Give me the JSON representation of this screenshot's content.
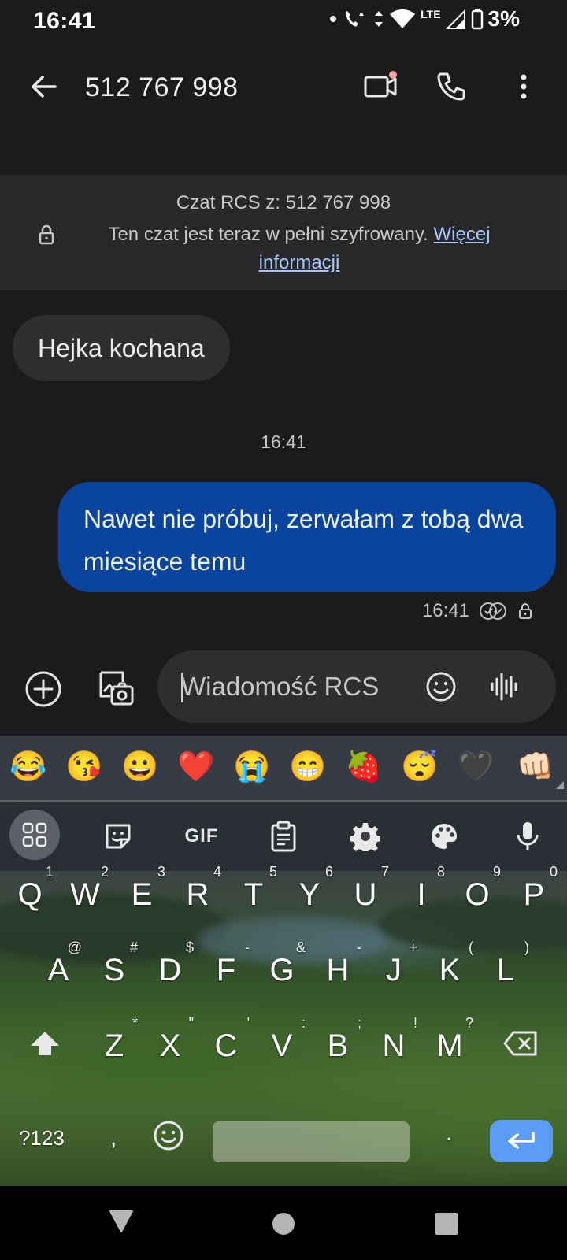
{
  "status_bar": {
    "time": "16:41",
    "network": "LTE",
    "battery": "3%"
  },
  "app_bar": {
    "title": "512 767 998",
    "icons": [
      "back-arrow-icon",
      "video-call-icon",
      "phone-icon",
      "more-vert-icon"
    ]
  },
  "banner": {
    "line1": "Czat RCS z: 512 767 998",
    "line2": "Ten czat jest teraz w pełni szyfrowany.",
    "link": "Więcej informacji"
  },
  "messages": {
    "incoming": "Hejka kochana",
    "timestamp": "16:41",
    "outgoing": "Nawet nie próbuj, zerwałam z tobą dwa miesiące temu",
    "outgoing_time": "16:41"
  },
  "compose": {
    "placeholder": "Wiadomość RCS"
  },
  "keyboard": {
    "emoji_suggestions": [
      "😂",
      "😘",
      "😀",
      "❤️",
      "😭",
      "😁",
      "🍓",
      "😴",
      "🖤",
      "👊🏻"
    ],
    "tools": {
      "gif": "GIF"
    },
    "row1": [
      [
        "Q",
        "1"
      ],
      [
        "W",
        "2"
      ],
      [
        "E",
        "3"
      ],
      [
        "R",
        "4"
      ],
      [
        "T",
        "5"
      ],
      [
        "Y",
        "6"
      ],
      [
        "U",
        "7"
      ],
      [
        "I",
        "8"
      ],
      [
        "O",
        "9"
      ],
      [
        "P",
        "0"
      ]
    ],
    "row2": [
      [
        "A",
        "@"
      ],
      [
        "S",
        "#"
      ],
      [
        "D",
        "$"
      ],
      [
        "F",
        "-"
      ],
      [
        "G",
        "&"
      ],
      [
        "H",
        "-"
      ],
      [
        "J",
        "+"
      ],
      [
        "K",
        "("
      ],
      [
        "L",
        ")"
      ]
    ],
    "row3": [
      [
        "Z",
        "*"
      ],
      [
        "X",
        "\""
      ],
      [
        "C",
        "'"
      ],
      [
        "V",
        ":"
      ],
      [
        "B",
        ";"
      ],
      [
        "N",
        "!"
      ],
      [
        "M",
        "?"
      ]
    ],
    "symbols_key": "?123",
    "comma": ",",
    "period": "."
  },
  "colors": {
    "background": "#1b1b1d",
    "outgoing_bubble": "#0b449c",
    "incoming_bubble": "#2e2e31",
    "link": "#a8c7fa",
    "enter_key": "#5c9cf6"
  }
}
